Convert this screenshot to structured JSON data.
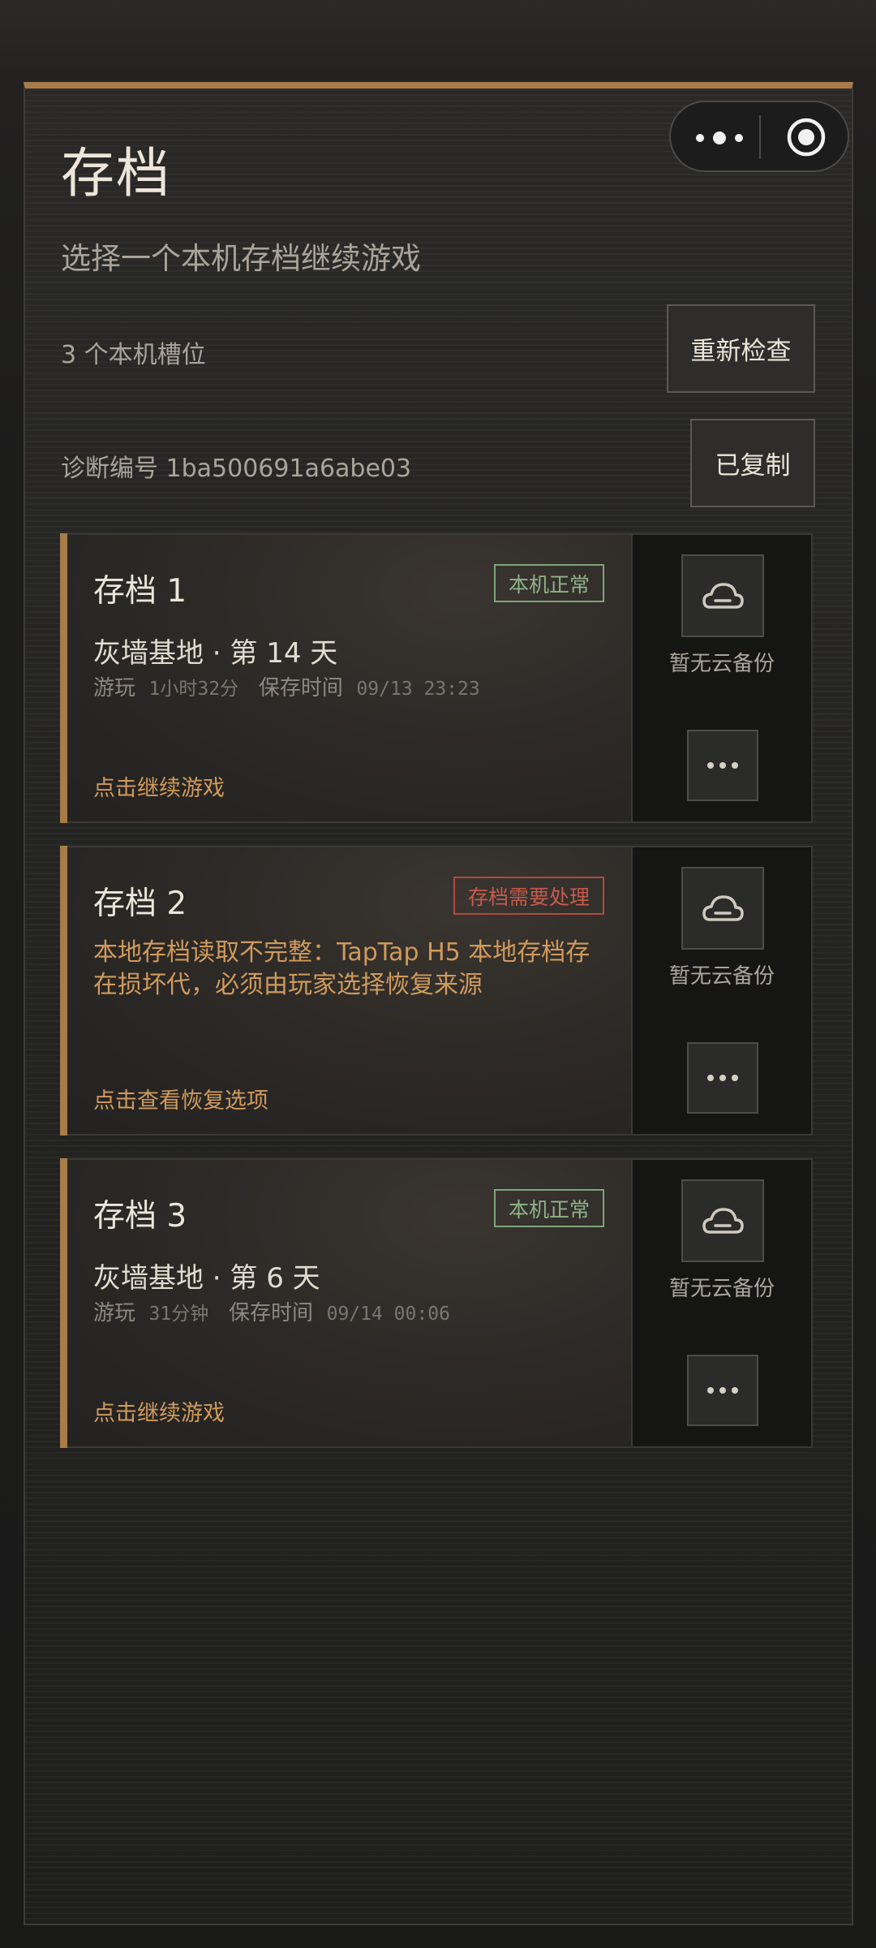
{
  "page": {
    "title": "存档",
    "subtitle": "选择一个本机存档继续游戏",
    "slots_count_label": "3 个本机槽位",
    "diagnostic_label": "诊断编号 1ba500691a6abe03",
    "recheck_button": "重新检查",
    "copied_button": "已复制"
  },
  "capsule": {
    "more_icon": "more-dots-icon",
    "target_icon": "target-icon"
  },
  "colors": {
    "accent": "#a87c48",
    "ok_badge": "#8fb28a",
    "warn_badge": "#c65a4c",
    "action_text": "#d09a5c"
  },
  "slots": [
    {
      "name": "存档 1",
      "badge": "本机正常",
      "status": "ok",
      "base": "灰墙基地 · 第 14 天",
      "playtime_label": "游玩",
      "playtime": "1小时32分",
      "saved_label": "保存时间",
      "saved_time": "09/13 23:23",
      "action": "点击继续游戏",
      "cloud_status": "暂无云备份",
      "cloud_icon": "cloud-icon",
      "more_icon": "more-horizontal-icon"
    },
    {
      "name": "存档 2",
      "badge": "存档需要处理",
      "status": "warn",
      "message": "本地存档读取不完整：TapTap H5 本地存档存在损坏代，必须由玩家选择恢复来源",
      "action": "点击查看恢复选项",
      "cloud_status": "暂无云备份",
      "cloud_icon": "cloud-icon",
      "more_icon": "more-horizontal-icon"
    },
    {
      "name": "存档 3",
      "badge": "本机正常",
      "status": "ok",
      "base": "灰墙基地 · 第 6 天",
      "playtime_label": "游玩",
      "playtime": "31分钟",
      "saved_label": "保存时间",
      "saved_time": "09/14 00:06",
      "action": "点击继续游戏",
      "cloud_status": "暂无云备份",
      "cloud_icon": "cloud-icon",
      "more_icon": "more-horizontal-icon"
    }
  ]
}
